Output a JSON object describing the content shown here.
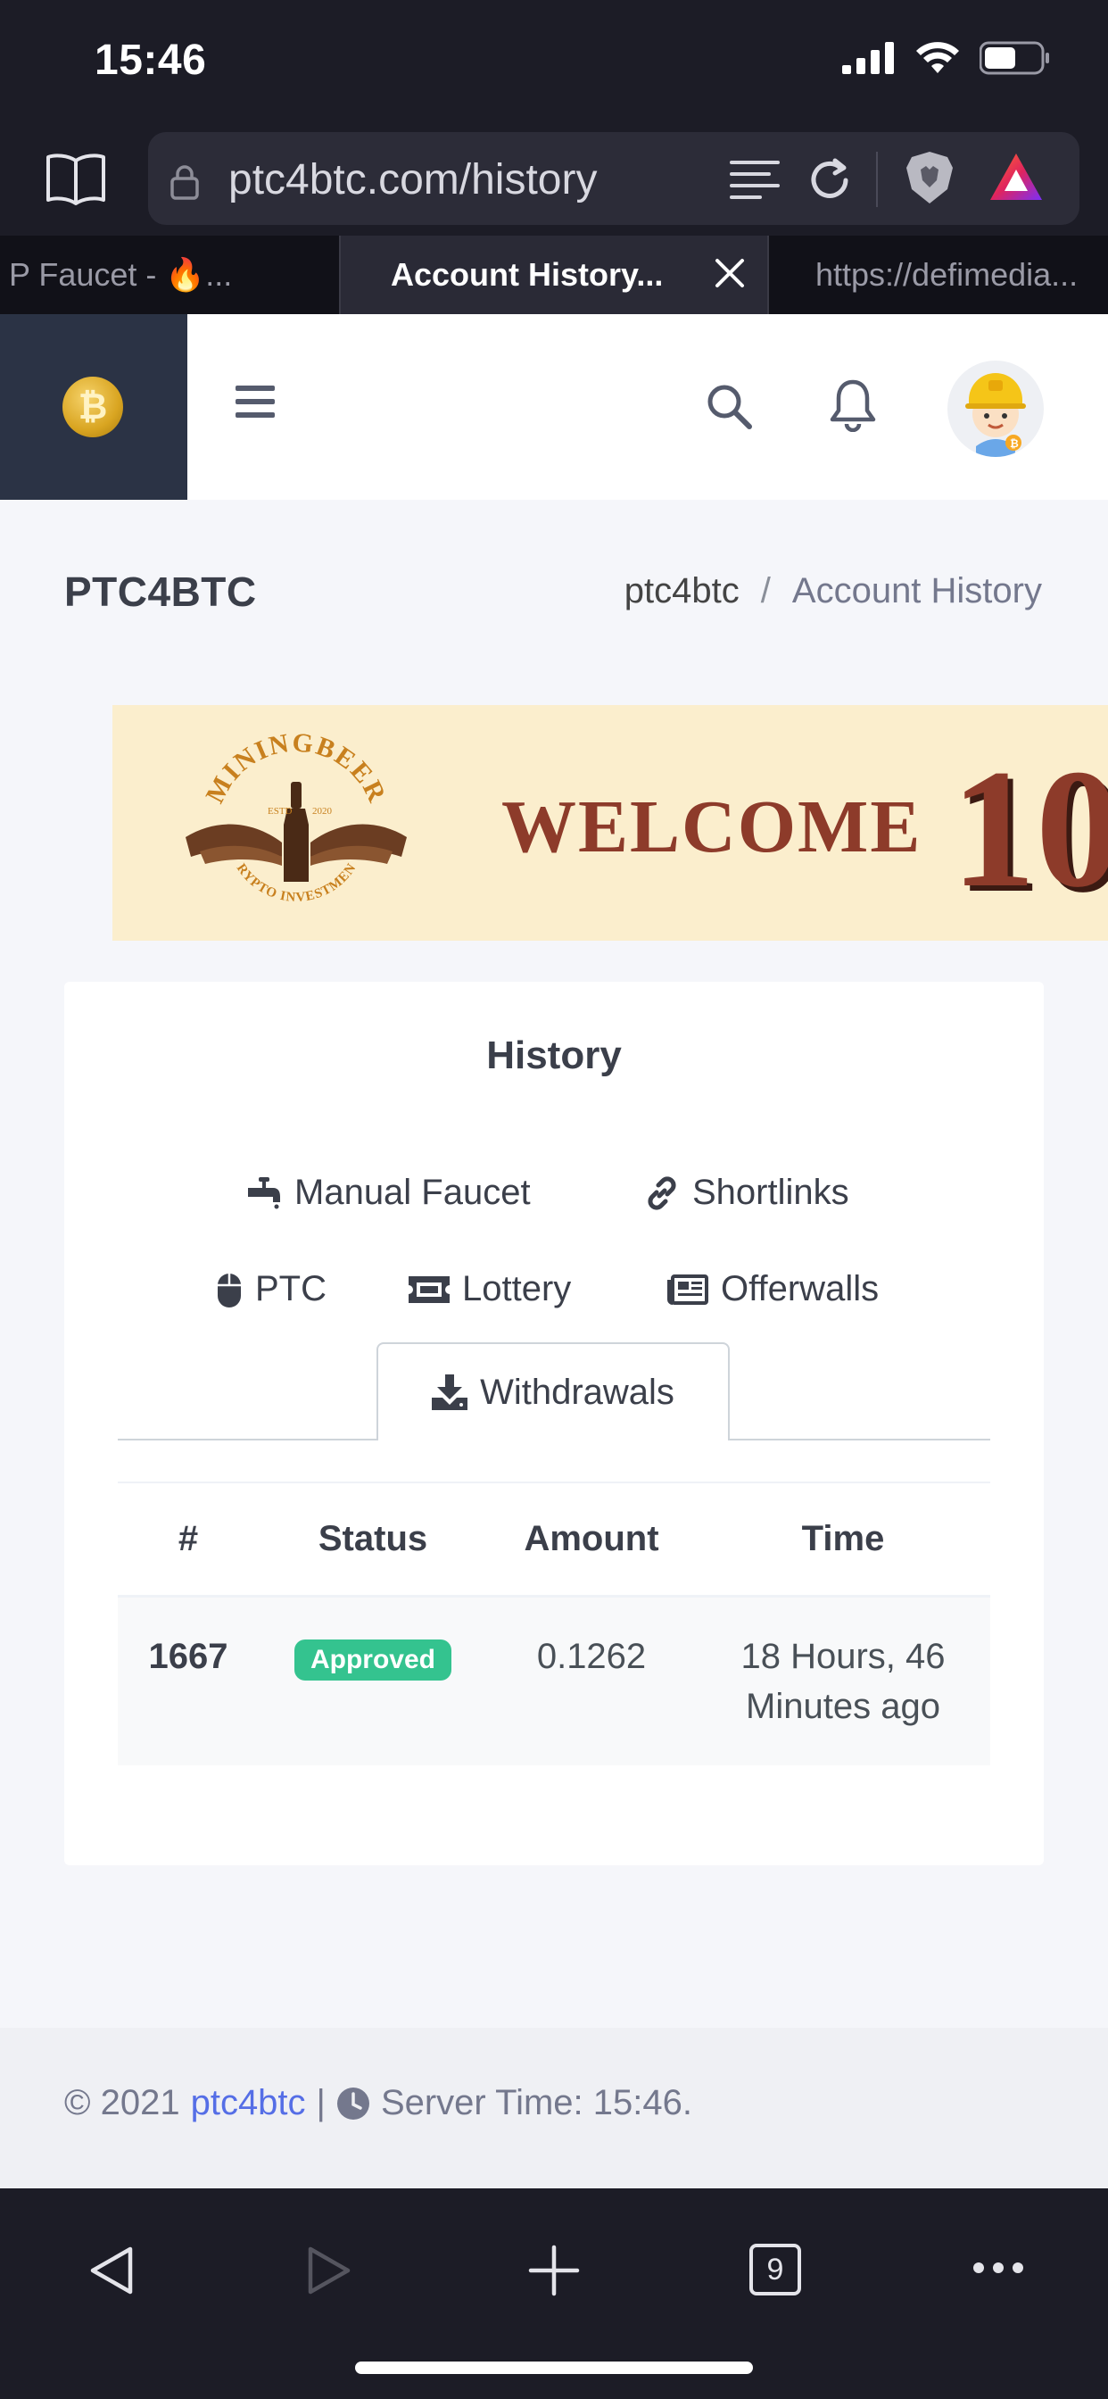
{
  "status_bar": {
    "time": "15:46"
  },
  "browser": {
    "url": "ptc4btc.com/history",
    "tabs": [
      {
        "label": "P Faucet - 🔥..."
      },
      {
        "label": "Account History..."
      },
      {
        "label": "https://defimedia..."
      }
    ],
    "tab_count": "9"
  },
  "header": {
    "logo_glyph": "₿"
  },
  "page": {
    "title": "PTC4BTC",
    "breadcrumb": [
      "ptc4btc",
      "/",
      "Account History"
    ]
  },
  "banner": {
    "brand": "MININGBEER",
    "tagline": "CRYPTO INVESTMENT",
    "estd": "ESTD",
    "year": "2020",
    "welcome": "WELCOME",
    "big_text": "10"
  },
  "history": {
    "title": "History",
    "tabs": {
      "faucet": "Manual Faucet",
      "shortlinks": "Shortlinks",
      "ptc": "PTC",
      "lottery": "Lottery",
      "offerwalls": "Offerwalls",
      "withdrawals": "Withdrawals"
    },
    "active_tab": "withdrawals",
    "columns": [
      "#",
      "Status",
      "Amount",
      "Time"
    ],
    "rows": [
      {
        "id": "1667",
        "status": "Approved",
        "amount": "0.1262",
        "time": "18 Hours, 46 Minutes ago"
      }
    ]
  },
  "footer": {
    "copyright": "© 2021",
    "site_link": "ptc4btc",
    "separator": "|",
    "server_time": "Server Time: 15:46."
  },
  "colors": {
    "accent": "#556ee6",
    "success": "#34c38f",
    "logo_panel": "#2b3345",
    "banner_bg": "#fbeecd",
    "banner_text": "#8d3b2a"
  },
  "icons": [
    "book-icon",
    "lock-icon",
    "reader-icon",
    "reload-icon",
    "brave-shield-icon",
    "rewards-icon",
    "close-icon",
    "hamburger-icon",
    "search-icon",
    "bell-icon",
    "faucet-icon",
    "link-icon",
    "mouse-icon",
    "ticket-icon",
    "newspaper-icon",
    "download-icon",
    "clock-icon",
    "back-icon",
    "forward-icon",
    "plus-icon",
    "tabs-icon",
    "more-icon"
  ]
}
